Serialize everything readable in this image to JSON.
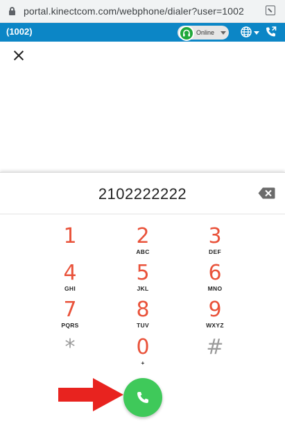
{
  "browser": {
    "url": "portal.kinectcom.com/webphone/dialer?user=1002"
  },
  "header": {
    "extension": "(1002)",
    "status": "Online",
    "accent_color": "#0c86c6",
    "status_color": "#1fa83a"
  },
  "dialer": {
    "number": "2102222222",
    "keys": [
      {
        "digit": "1",
        "letters": ""
      },
      {
        "digit": "2",
        "letters": "ABC"
      },
      {
        "digit": "3",
        "letters": "DEF"
      },
      {
        "digit": "4",
        "letters": "GHI"
      },
      {
        "digit": "5",
        "letters": "JKL"
      },
      {
        "digit": "6",
        "letters": "MNO"
      },
      {
        "digit": "7",
        "letters": "PQRS"
      },
      {
        "digit": "8",
        "letters": "TUV"
      },
      {
        "digit": "9",
        "letters": "WXYZ"
      },
      {
        "digit": "*",
        "letters": ""
      },
      {
        "digit": "0",
        "letters": "+"
      },
      {
        "digit": "#",
        "letters": ""
      }
    ],
    "digit_color": "#e9523a",
    "call_color": "#3fc95a",
    "annotation_color": "#e8231f"
  },
  "icons": {
    "lock": "lock-icon",
    "tab": "open-tab-icon",
    "headset": "headset-icon",
    "globe": "globe-icon",
    "phone_header": "phone-call-icon",
    "close": "close-icon",
    "backspace": "backspace-icon",
    "call": "phone-icon",
    "arrow": "arrow-right-icon"
  }
}
